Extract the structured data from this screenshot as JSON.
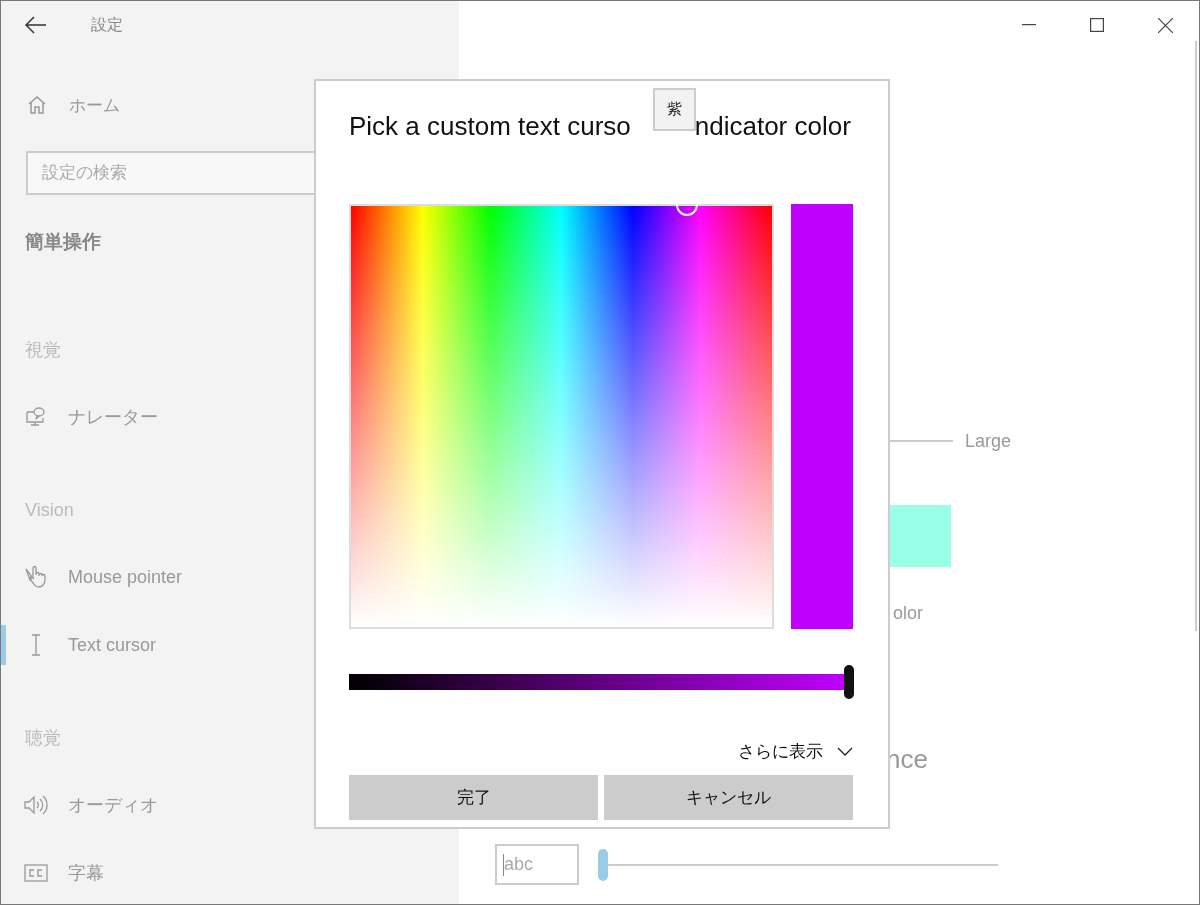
{
  "window": {
    "title": "設定"
  },
  "sidebar": {
    "home": "ホーム",
    "search": {
      "placeholder": "設定の検索"
    },
    "section_title": "簡単操作",
    "groups": [
      {
        "heading": "視覚",
        "items": [
          {
            "label": "ナレーター",
            "kind": "narrator",
            "selected": false
          }
        ]
      },
      {
        "heading": "Vision",
        "items": [
          {
            "label": "Mouse pointer",
            "kind": "mouse",
            "selected": false
          },
          {
            "label": "Text cursor",
            "kind": "cursor",
            "selected": true
          }
        ]
      },
      {
        "heading": "聴覚",
        "items": [
          {
            "label": "オーディオ",
            "kind": "audio",
            "selected": false
          },
          {
            "label": "字幕",
            "kind": "captions",
            "selected": false
          }
        ]
      }
    ]
  },
  "content": {
    "size_label": "Large",
    "color_caption": "olor",
    "heading": "nce",
    "preview_field": {
      "value": "abc"
    },
    "thickness_slider": {
      "level": 0
    }
  },
  "dialog": {
    "title": [
      "Pick a custom text curso",
      "ndicator color"
    ],
    "tooltip": "紫",
    "brightness": {
      "level": 1
    },
    "more": {
      "label": "さらに表示",
      "expanded": false
    },
    "buttons": [
      "完了",
      "キャンセル"
    ]
  }
}
